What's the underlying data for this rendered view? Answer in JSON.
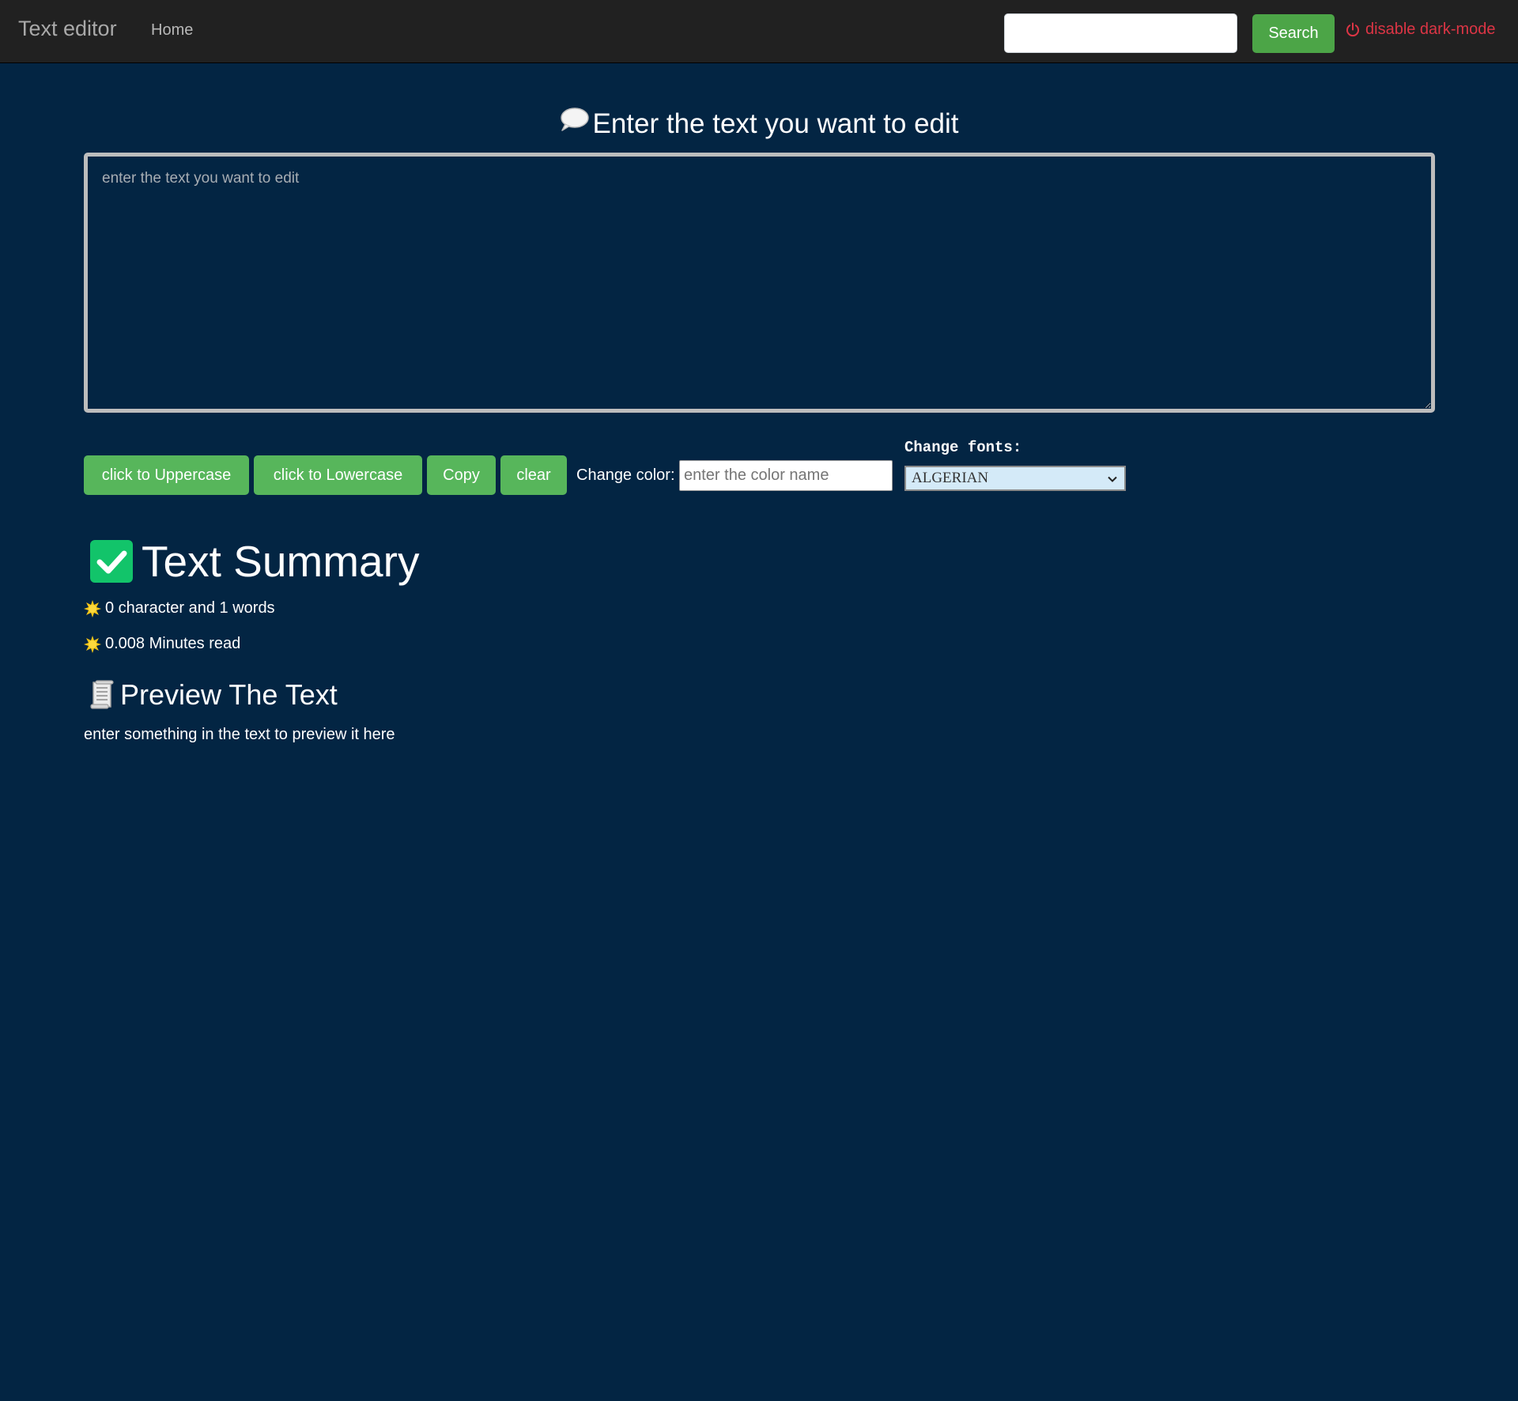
{
  "navbar": {
    "brand": "Text editor",
    "home_link": "Home",
    "search": {
      "value": "",
      "placeholder": ""
    },
    "search_button": "Search",
    "dark_mode_toggle": "disable dark-mode"
  },
  "editor": {
    "heading": "Enter the text you want to edit",
    "heading_icon": "speech-bubble-icon",
    "textarea": {
      "value": "",
      "placeholder": "enter the text you want to edit"
    }
  },
  "actions": {
    "uppercase": "click to Uppercase",
    "lowercase": "click to Lowercase",
    "copy": "Copy",
    "clear": "clear",
    "color_label": "Change color:",
    "color_input": {
      "value": "",
      "placeholder": "enter the color name"
    },
    "fonts_label": "Change fonts:",
    "font_selected": "ALGERIAN"
  },
  "summary": {
    "heading": "Text Summary",
    "heading_icon": "check-mark-icon",
    "characters_words": "0 character and 1 words",
    "read_time": "0.008 Minutes read",
    "stat_icon": "sun-icon"
  },
  "preview": {
    "heading": "Preview The Text",
    "heading_icon": "scroll-icon",
    "text": "enter something in the text to preview it here"
  },
  "colors": {
    "background": "#032543",
    "navbar": "#212121",
    "button_green": "#57b65b",
    "search_green": "#4ca547",
    "dark_mode_red": "#dc3545",
    "check_green": "#12c46a",
    "select_bg": "#d4eaf8"
  }
}
